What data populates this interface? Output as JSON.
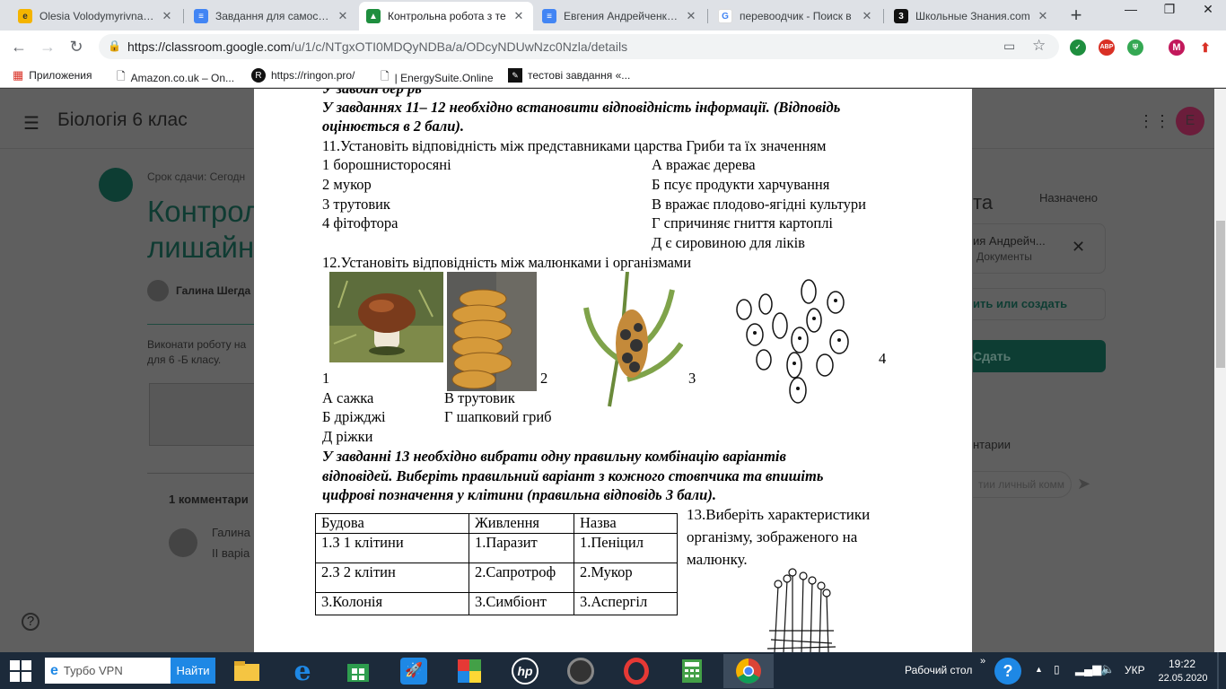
{
  "browser": {
    "tabs": [
      {
        "title": "Olesia Volodymyrivna | E",
        "active": false
      },
      {
        "title": "Завдання для самостійн",
        "active": false
      },
      {
        "title": "Контрольна робота з те",
        "active": true
      },
      {
        "title": "Евгения Андрейченко -",
        "active": false
      },
      {
        "title": "перевоодчик - Поиск в",
        "active": false
      },
      {
        "title": "Школьные Знания.com",
        "active": false
      }
    ],
    "url_host": "https://classroom.google.com",
    "url_path": "/u/1/c/NTgxOTI0MDQyNDBa/a/ODcyNDUwNzc0Nzla/details",
    "bookmarks": [
      "Приложения",
      "Amazon.co.uk – On...",
      "https://ringon.pro/",
      "| EnergySuite.Online",
      "тестові завдання «..."
    ],
    "profile_letter": "M",
    "abp_label": "ABP"
  },
  "classroom": {
    "course_title": "Біологія 6 клас",
    "due": "Срок сдачи: Сегодн",
    "assignment_title_1": "Контрол",
    "assignment_title_2": "лишайн",
    "teacher": "Галина Шегда",
    "description_1": "Виконати роботу на",
    "description_2": "для 6 -Б класу.",
    "comments": "1 комментари",
    "commenter": "Галина",
    "comment_text": "ІІ варіа",
    "panel_title": "та",
    "status": "Назначено",
    "attachment_name": "ия Андрейч...",
    "attachment_type": "Документы",
    "add_create": "ить или создать",
    "submit": "Сдать",
    "private_comments": "нтарии",
    "comment_placeholder": "тии личный комм",
    "avatar_letter": "Е"
  },
  "document": {
    "top_fragment": "У завдан                    дер               рь",
    "instr1_l1": "У завданнях 11– 12 необхідно встановити відповідність інформації. (Відповідь",
    "instr1_l2": "оцінюється в 2 бали).",
    "q11": "11.Установіть відповідність між представниками царства Гриби та їх значенням",
    "q11_left": [
      "1  борошнисторосяні",
      "2  мукор",
      "3  трутовик",
      "4 фітофтора"
    ],
    "q11_right": [
      "А  вражає дерева",
      "Б  псує продукти харчування",
      "В  вражає плодово-ягідні культури",
      "Г  спричиняє гниття картоплі",
      "Д  є сировиною для ліків"
    ],
    "q12": "12.Установіть відповідність між малюнками і організмами",
    "pic_nums": [
      "1",
      "2",
      "3",
      "4"
    ],
    "q12_opts": [
      "А сажка",
      "В трутовик",
      "Б дріжджі",
      "Г шапковий гриб",
      "Д ріжки"
    ],
    "instr2_l1": "У завданні 13 необхідно вибрати одну правильну  комбінацію варіантів",
    "instr2_l2": "відповідей. Виберіть правильний варіант з кожного стовпчика та впишіть",
    "instr2_l3": "цифрові позначення у клітини (правильна відповідь 3 бали).",
    "table": [
      [
        "Будова",
        "Живлення",
        "Назва"
      ],
      [
        "1.З 1 клітини",
        "1.Паразит",
        "1.Пеніцил"
      ],
      [
        "2.З 2 клітин",
        "2.Сапротроф",
        "2.Мукор"
      ],
      [
        "3.Колонія",
        "3.Симбіонт",
        "3.Аспергіл"
      ]
    ],
    "q13_l1": "13.Виберіть характеристики",
    "q13_l2": "організму, зображеного на",
    "q13_l3": "малюнку."
  },
  "taskbar": {
    "search_text": "Турбо VPN",
    "search_button": "Найти",
    "desktop_label": "Рабочий стол",
    "lang": "УКР",
    "time": "19:22",
    "date": "22.05.2020"
  }
}
